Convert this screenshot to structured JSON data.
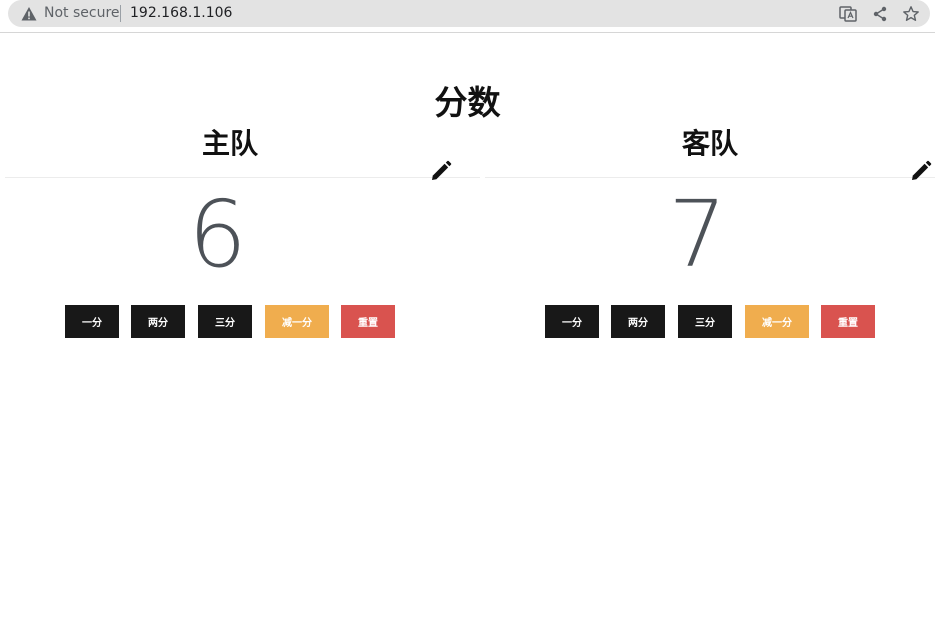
{
  "browser": {
    "security_label": "Not secure",
    "url": "192.168.1.106"
  },
  "page": {
    "title": "分数"
  },
  "teams": [
    {
      "name": "主队",
      "score": "6",
      "buttons": {
        "one": "一分",
        "two": "两分",
        "three": "三分",
        "minus": "减一分",
        "reset": "重置"
      }
    },
    {
      "name": "客队",
      "score": "7",
      "buttons": {
        "one": "一分",
        "two": "两分",
        "three": "三分",
        "minus": "减一分",
        "reset": "重置"
      }
    }
  ],
  "colors": {
    "dark_button": "#181818",
    "minus_button": "#f0ad4e",
    "reset_button": "#d9534f",
    "score_text": "#4d5258"
  },
  "icons": [
    "warning-icon",
    "translate-icon",
    "share-icon",
    "star-icon",
    "pencil-icon"
  ]
}
